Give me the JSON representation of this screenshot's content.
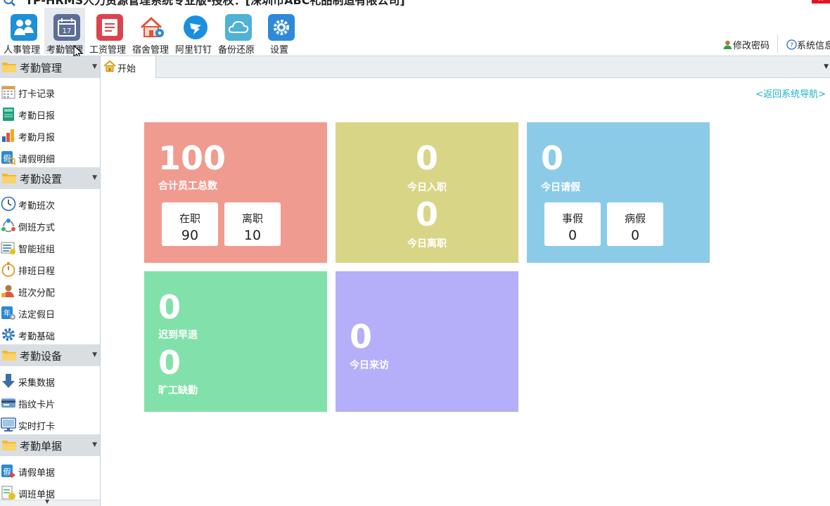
{
  "window": {
    "title": "TP-HRMS人力资源管理系统专业版-授权：[深圳市ABC礼品制造有限公司]"
  },
  "toolbar": {
    "items": [
      {
        "label": "人事管理",
        "icon": "personnel-icon",
        "color": "#1e8fd8"
      },
      {
        "label": "考勤管理",
        "icon": "calendar-icon",
        "color": "#5c6e96"
      },
      {
        "label": "工资管理",
        "icon": "payroll-icon",
        "color": "#d9454e"
      },
      {
        "label": "宿舍管理",
        "icon": "dormitory-icon",
        "color": "#e0553f"
      },
      {
        "label": "阿里钉钉",
        "icon": "dingtalk-icon",
        "color": "#1a8fe0"
      },
      {
        "label": "备份还原",
        "icon": "cloud-icon",
        "color": "#4fb2d4"
      },
      {
        "label": "设置",
        "icon": "gear-icon",
        "color": "#2e8ad8"
      }
    ],
    "change_password": "修改密码",
    "system_info": "系统信息"
  },
  "tabs": {
    "start": "开始"
  },
  "sidebar": {
    "groups": [
      {
        "title": "考勤管理",
        "items": [
          {
            "label": "打卡记录",
            "icon": "punch-record-icon"
          },
          {
            "label": "考勤日报",
            "icon": "daily-report-icon"
          },
          {
            "label": "考勤月报",
            "icon": "monthly-report-icon"
          },
          {
            "label": "请假明细",
            "icon": "leave-detail-icon"
          }
        ]
      },
      {
        "title": "考勤设置",
        "items": [
          {
            "label": "考勤班次",
            "icon": "clock-icon"
          },
          {
            "label": "倒班方式",
            "icon": "shift-rotation-icon"
          },
          {
            "label": "智能班组",
            "icon": "smart-group-icon"
          },
          {
            "label": "排班日程",
            "icon": "stopwatch-icon"
          },
          {
            "label": "班次分配",
            "icon": "user-assign-icon"
          },
          {
            "label": "法定假日",
            "icon": "holiday-icon"
          },
          {
            "label": "考勤基础",
            "icon": "settings-icon"
          }
        ]
      },
      {
        "title": "考勤设备",
        "items": [
          {
            "label": "采集数据",
            "icon": "download-arrow-icon"
          },
          {
            "label": "指纹卡片",
            "icon": "card-icon"
          },
          {
            "label": "实时打卡",
            "icon": "monitor-icon"
          }
        ]
      },
      {
        "title": "考勤单据",
        "items": [
          {
            "label": "请假单据",
            "icon": "leave-form-icon"
          },
          {
            "label": "调班单据",
            "icon": "shift-form-icon"
          }
        ]
      }
    ]
  },
  "main": {
    "back_link": "<返回系统导航>",
    "cards": {
      "total": {
        "value": "100",
        "label": "合计员工总数",
        "color": "#f09b8f",
        "subs": [
          {
            "label": "在职",
            "value": "90"
          },
          {
            "label": "离职",
            "value": "10"
          }
        ]
      },
      "entry": {
        "value1": "0",
        "label1": "今日入职",
        "value2": "0",
        "label2": "今日离职",
        "color": "#d9d586"
      },
      "leave": {
        "value": "0",
        "label": "今日请假",
        "color": "#8ccbe8",
        "subs": [
          {
            "label": "事假",
            "value": "0"
          },
          {
            "label": "病假",
            "value": "0"
          }
        ]
      },
      "late": {
        "value1": "0",
        "label1": "迟到早退",
        "value2": "0",
        "label2": "旷工缺勤",
        "color": "#82e1aa"
      },
      "visitor": {
        "value": "0",
        "label": "今日来访",
        "color": "#b5aef8"
      }
    }
  }
}
